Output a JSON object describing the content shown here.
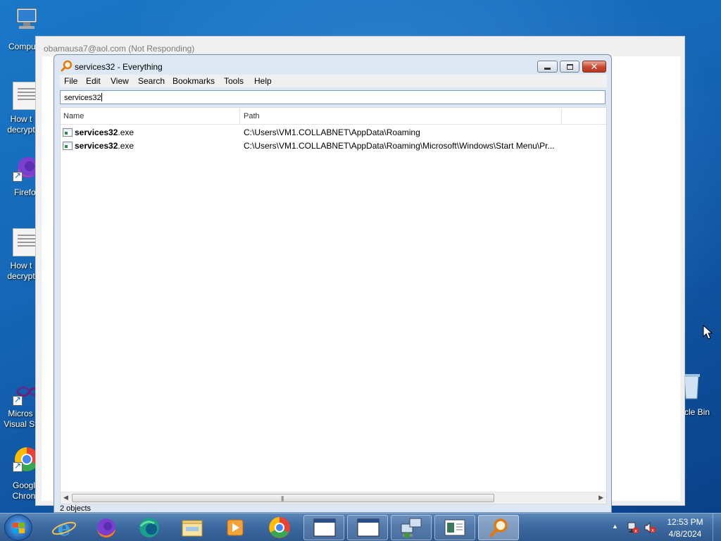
{
  "desktop": {
    "icons": [
      {
        "label": "Compu",
        "type": "computer"
      },
      {
        "label": "How t decrypt",
        "type": "document"
      },
      {
        "label": "Firefo",
        "type": "firefox"
      },
      {
        "label": "How t decrypt",
        "type": "document"
      },
      {
        "label": "Micros Visual St",
        "type": "visual-studio"
      },
      {
        "label": "Googl Chron",
        "type": "chrome"
      },
      {
        "label": "cle Bin",
        "type": "recycle-bin"
      }
    ]
  },
  "background_window": {
    "title": "obamausa7@aol.com (Not Responding)"
  },
  "window": {
    "title": "services32 - Everything",
    "menu": [
      "File",
      "Edit",
      "View",
      "Search",
      "Bookmarks",
      "Tools",
      "Help"
    ],
    "search_value": "services32",
    "columns": {
      "name": "Name",
      "path": "Path"
    },
    "rows": [
      {
        "name_bold": "services32",
        "name_ext": ".exe",
        "path": "C:\\Users\\VM1.COLLABNET\\AppData\\Roaming"
      },
      {
        "name_bold": "services32",
        "name_ext": ".exe",
        "path": "C:\\Users\\VM1.COLLABNET\\AppData\\Roaming\\Microsoft\\Windows\\Start Menu\\Pr..."
      }
    ],
    "status": "2 objects"
  },
  "taskbar": {
    "pinned": [
      "internet-explorer",
      "firefox",
      "edge",
      "file-explorer",
      "media-player",
      "chrome"
    ],
    "clock_time": "12:53 PM",
    "clock_date": "4/8/2024"
  },
  "colors": {
    "desktop": "#1565b5",
    "window_frame": "#dde8f4",
    "close_button": "#c7472f",
    "taskbar": "#3d6aa0"
  }
}
